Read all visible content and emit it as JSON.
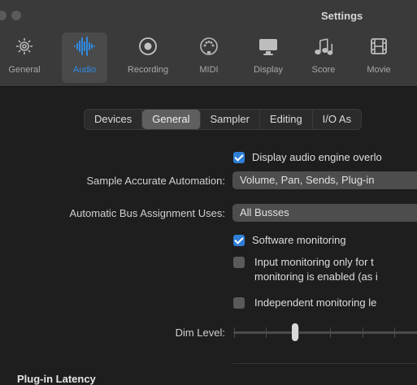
{
  "window": {
    "title": "Settings"
  },
  "toolbar": {
    "items": [
      {
        "label": "General",
        "icon": "gear-icon"
      },
      {
        "label": "Audio",
        "icon": "waveform-icon",
        "active": true
      },
      {
        "label": "Recording",
        "icon": "record-icon"
      },
      {
        "label": "MIDI",
        "icon": "midi-port-icon"
      },
      {
        "label": "Display",
        "icon": "display-icon"
      },
      {
        "label": "Score",
        "icon": "music-notes-icon"
      },
      {
        "label": "Movie",
        "icon": "film-icon"
      }
    ],
    "accent": "#2f8ae6"
  },
  "tabs": [
    "Devices",
    "General",
    "Sampler",
    "Editing",
    "I/O As"
  ],
  "selected_tab": "General",
  "general": {
    "display_overload": {
      "label": "Display audio engine overlo",
      "checked": true
    },
    "sample_accurate_label": "Sample Accurate Automation:",
    "sample_accurate_value": "Volume, Pan, Sends, Plug-in",
    "bus_label": "Automatic Bus Assignment Uses:",
    "bus_value": "All Busses",
    "software_monitoring": {
      "label": "Software monitoring",
      "checked": true
    },
    "input_monitoring": {
      "line1": "Input monitoring only for t",
      "line2": "monitoring is enabled (as i",
      "checked": false
    },
    "independent_monitoring": {
      "label": "Independent monitoring le",
      "checked": false
    },
    "dim_level_label": "Dim Level:",
    "dim_level_fraction": 0.36
  },
  "section": {
    "plugin_latency": "Plug-in Latency"
  },
  "colors": {
    "checkbox_on": "#2f7fd8",
    "selected_tab": "#5f5f5f"
  }
}
